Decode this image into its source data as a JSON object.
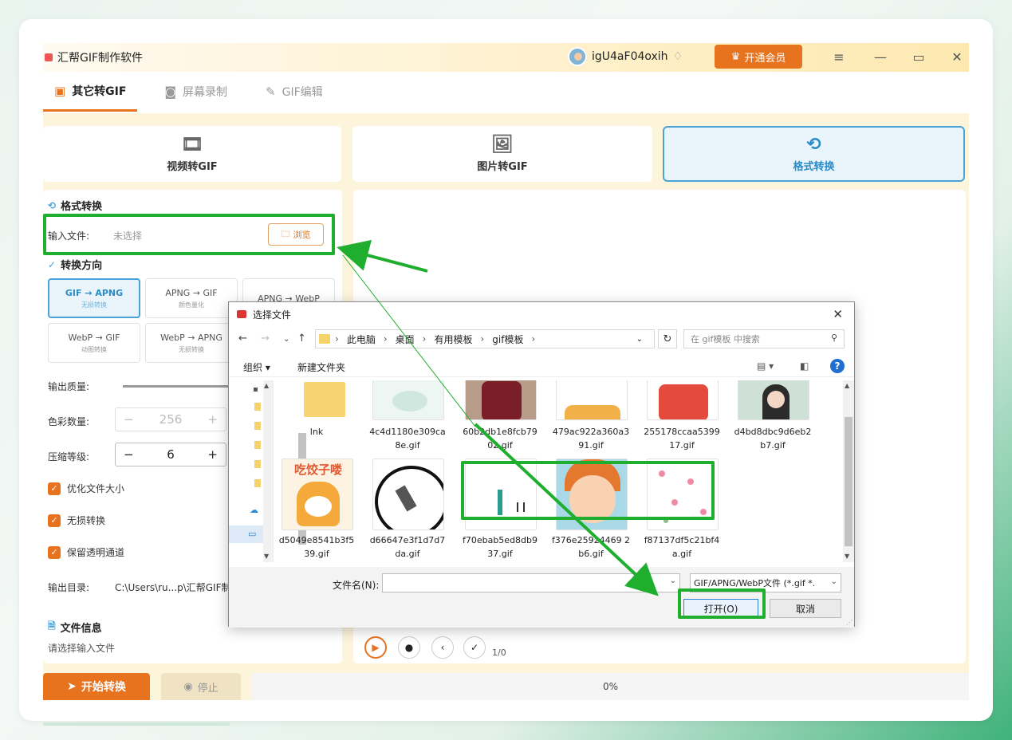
{
  "app": {
    "title": "汇帮GIF制作软件",
    "username": "igU4aF04oxih",
    "vip_label": "开通会员",
    "colors": {
      "accent": "#e8731f",
      "selected": "#2a8bc9",
      "highlight": "#1fae2e"
    }
  },
  "tabs": [
    {
      "label": "其它转GIF",
      "icon": "image-icon",
      "active": true
    },
    {
      "label": "屏幕录制",
      "icon": "camera-icon",
      "active": false
    },
    {
      "label": "GIF编辑",
      "icon": "edit-icon",
      "active": false
    }
  ],
  "modes": [
    {
      "label": "视频转GIF",
      "icon": "video-icon"
    },
    {
      "label": "图片转GIF",
      "icon": "picture-icon"
    },
    {
      "label": "格式转换",
      "icon": "convert-icon",
      "selected": true
    }
  ],
  "panel": {
    "section_title": "格式转换",
    "input_label": "输入文件:",
    "input_value": "未选择",
    "browse_label": "浏览",
    "direction_title": "转换方向",
    "directions": [
      {
        "label": "GIF → APNG",
        "sub": "无损转换",
        "selected": true
      },
      {
        "label": "APNG → GIF",
        "sub": "颜色量化"
      },
      {
        "label": "APNG → WebP",
        "sub": ""
      },
      {
        "label": "WebP → GIF",
        "sub": "动图转换"
      },
      {
        "label": "WebP → APNG",
        "sub": "无损转换"
      }
    ],
    "quality_label": "输出质量:",
    "colors_label": "色彩数量:",
    "colors_value": "256",
    "compress_label": "压缩等级:",
    "compress_value": "6",
    "checks": [
      "优化文件大小",
      "无损转换",
      "保留透明通道"
    ],
    "output_label": "输出目录:",
    "output_value": "C:\\Users\\ru...p\\汇帮GIF制",
    "info_title": "文件信息",
    "info_text": "请选择输入文件"
  },
  "player": {
    "counter": "1/0"
  },
  "bottom": {
    "start_label": "开始转换",
    "stop_label": "停止",
    "progress": "0%"
  },
  "dialog": {
    "title": "选择文件",
    "path": [
      "此电脑",
      "桌面",
      "有用模板",
      "gif模板"
    ],
    "search_placeholder": "在 gif模板 中搜索",
    "organize": "组织 ▾",
    "new_folder": "新建文件夹",
    "files_row1": [
      {
        "name": "lnk",
        "thumb": "folder"
      },
      {
        "name": "4c4d1180e309ca8e.gif",
        "thumb": "bird"
      },
      {
        "name": "60b2db1e8fcb7902.gif",
        "thumb": "person"
      },
      {
        "name": "479ac922a360a391.gif",
        "thumb": "tiger-small"
      },
      {
        "name": "255178ccaa539917.gif",
        "thumb": "tiger-red"
      },
      {
        "name": "d4bd8dbc9d6eb2b7.gif",
        "thumb": "girl"
      }
    ],
    "files_row2": [
      {
        "name": "d5049e8541b3f539.gif",
        "thumb": "tiger-text",
        "text": "吃饺子喽"
      },
      {
        "name": "d66647e3f1d7d7da.gif",
        "thumb": "blob"
      },
      {
        "name": "f70ebab5ed8db937.gif",
        "thumb": "walk"
      },
      {
        "name": "f376e25924469 2b6.gif",
        "thumb": "cartoon-face"
      },
      {
        "name": "f87137df5c21bf4a.gif",
        "thumb": "petals"
      }
    ],
    "filename_label": "文件名(N):",
    "filetype": "GIF/APNG/WebP文件 (*.gif *.",
    "open_label": "打开(O)",
    "cancel_label": "取消"
  }
}
